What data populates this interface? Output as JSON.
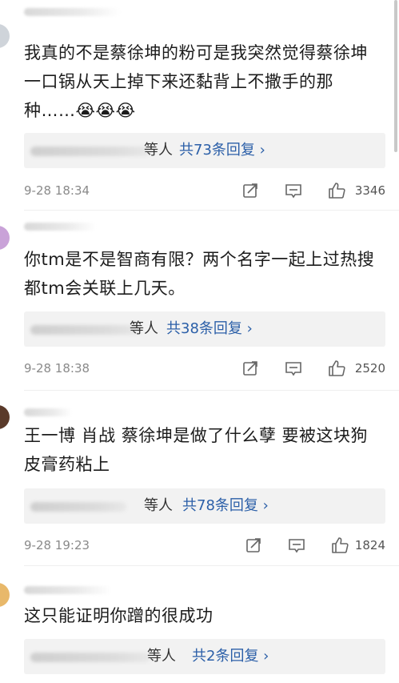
{
  "comments": [
    {
      "text": "我真的不是蔡徐坤的粉可是我突然觉得蔡徐坤一口锅从天上掉下来还黏背上不撒手的那种……😭😭😭",
      "reply_names": "等人",
      "reply_count": "共73条回复 ›",
      "time": "9-28 18:34",
      "likes": "3346"
    },
    {
      "text": "你tm是不是智商有限？两个名字一起上过热搜都tm会关联上几天。",
      "reply_names": "等人",
      "reply_count": "共38条回复 ›",
      "time": "9-28 18:38",
      "likes": "2520"
    },
    {
      "text": "王一博 肖战 蔡徐坤是做了什么孽 要被这块狗皮膏药粘上",
      "reply_names": "等人",
      "reply_count": "共78条回复 ›",
      "time": "9-28 19:23",
      "likes": "1824"
    },
    {
      "text": "这只能证明你蹭的很成功",
      "reply_names": "等人",
      "reply_count": "共2条回复 ›",
      "time": "",
      "likes": ""
    }
  ]
}
